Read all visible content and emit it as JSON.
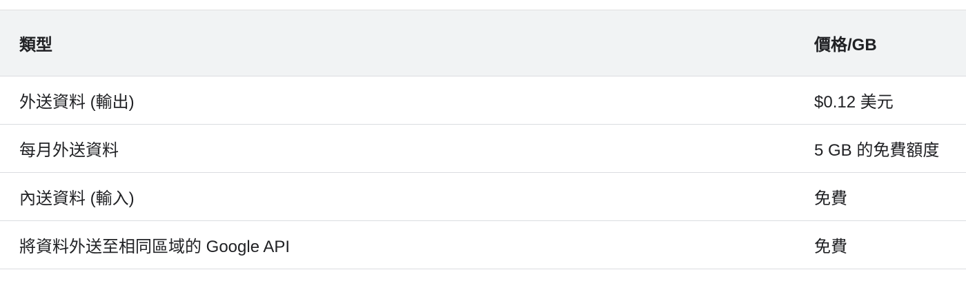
{
  "table": {
    "headers": {
      "type": "類型",
      "price": "價格/GB"
    },
    "rows": [
      {
        "type": "外送資料 (輸出)",
        "price": "$0.12 美元"
      },
      {
        "type": "每月外送資料",
        "price": "5 GB 的免費額度"
      },
      {
        "type": "內送資料 (輸入)",
        "price": "免費"
      },
      {
        "type": "將資料外送至相同區域的 Google API",
        "price": "免費"
      }
    ]
  }
}
